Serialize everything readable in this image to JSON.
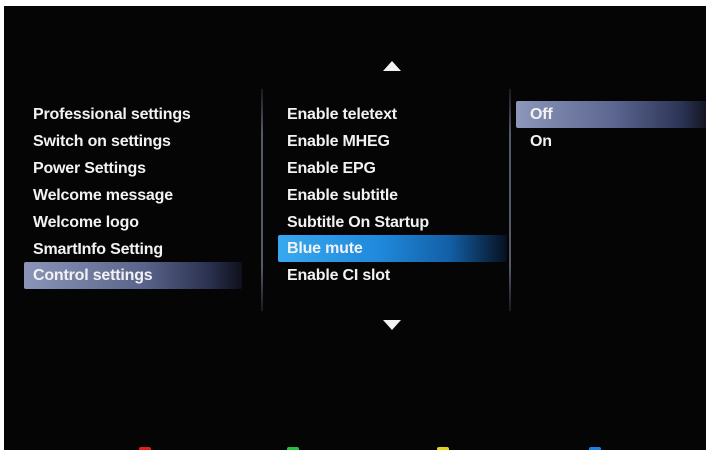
{
  "menu_left": {
    "items": [
      {
        "label": "Professional settings"
      },
      {
        "label": "Switch on settings"
      },
      {
        "label": "Power Settings"
      },
      {
        "label": "Welcome message"
      },
      {
        "label": "Welcome logo"
      },
      {
        "label": "SmartInfo Setting"
      },
      {
        "label": "Control settings",
        "selected": true
      }
    ]
  },
  "menu_middle": {
    "items": [
      {
        "label": "Enable teletext"
      },
      {
        "label": "Enable MHEG"
      },
      {
        "label": "Enable EPG"
      },
      {
        "label": "Enable subtitle"
      },
      {
        "label": "Subtitle On Startup"
      },
      {
        "label": "Blue mute",
        "selected": true
      },
      {
        "label": "Enable CI slot"
      }
    ],
    "scroll_up_icon": "triangle-up-icon",
    "scroll_down_icon": "triangle-down-icon"
  },
  "menu_right": {
    "options": [
      {
        "label": "Off",
        "selected": true
      },
      {
        "label": "On"
      }
    ]
  },
  "colors": {
    "background": "#050506",
    "text": "#f2f2f4",
    "highlight_focus": "#1f88da",
    "highlight_path": "#6a749a",
    "color_keys": [
      "#e02020",
      "#28c040",
      "#e8d020",
      "#2080e0"
    ]
  }
}
